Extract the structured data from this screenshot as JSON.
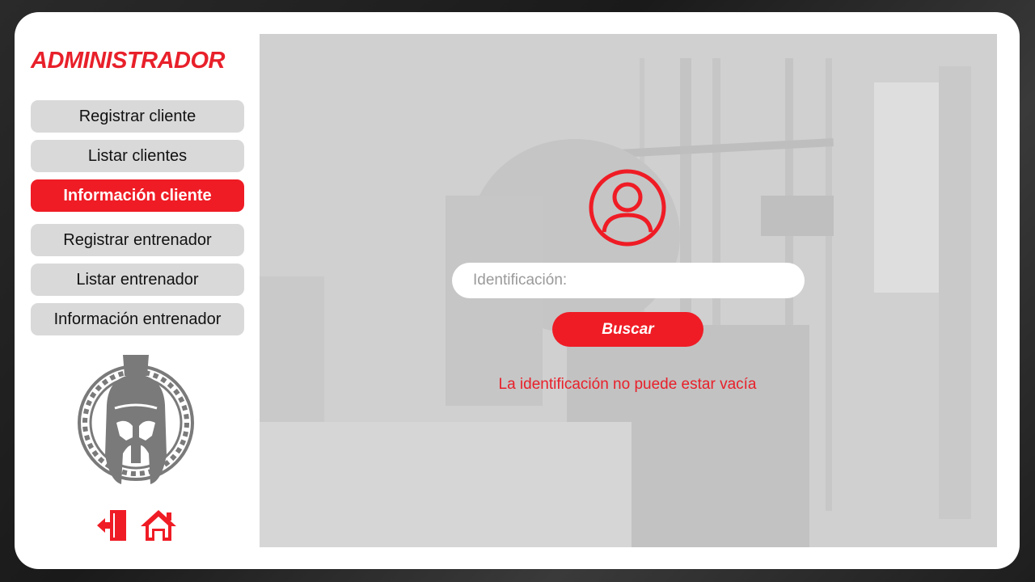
{
  "sidebar": {
    "title": "ADMINISTRADOR",
    "items": [
      {
        "label": "Registrar cliente"
      },
      {
        "label": "Listar clientes"
      },
      {
        "label": "Información cliente",
        "active": true
      },
      {
        "label": "Registrar entrenador"
      },
      {
        "label": "Listar entrenador"
      },
      {
        "label": "Información entrenador"
      }
    ],
    "logo_icon": "spartan-helmet-logo",
    "logout_icon": "logout-door-icon",
    "home_icon": "home-icon"
  },
  "main": {
    "avatar_icon": "user-circle-icon",
    "id_placeholder": "Identificación:",
    "id_value": "",
    "search_label": "Buscar",
    "error_message": "La identificación no puede estar vacía"
  },
  "colors": {
    "accent": "#ef1c25",
    "button_gray": "#d9d9d9",
    "panel_bg": "#cfcfcf"
  }
}
